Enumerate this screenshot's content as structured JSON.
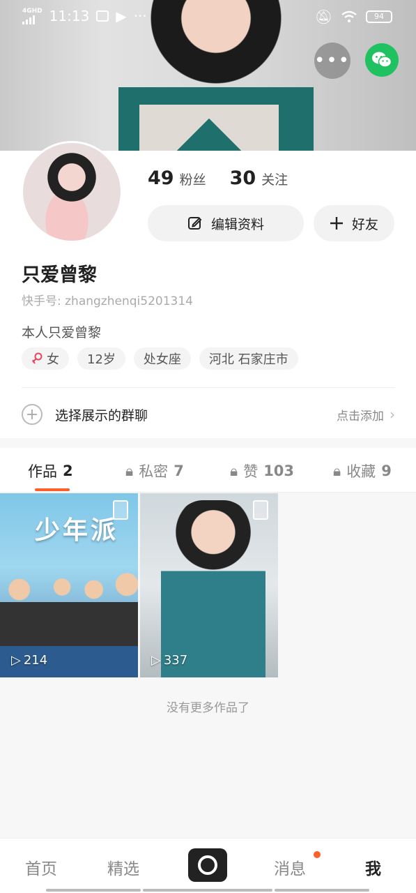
{
  "status_bar": {
    "network": "4GHD",
    "time": "11:13",
    "battery": "94"
  },
  "profile": {
    "followers_count": "49",
    "followers_label": "粉丝",
    "following_count": "30",
    "following_label": "关注",
    "edit_label": "编辑资料",
    "friend_label": "好友",
    "username": "只爱曾黎",
    "kuaishou_id": "快手号: zhangzhenqi5201314",
    "bio": "本人只爱曾黎",
    "tags": [
      "女",
      "12岁",
      "处女座",
      "河北 石家庄市"
    ],
    "group_label": "选择展示的群聊",
    "group_add": "点击添加"
  },
  "tabs": [
    {
      "label": "作品",
      "count": "2"
    },
    {
      "label": "私密",
      "count": "7"
    },
    {
      "label": "赞",
      "count": "103"
    },
    {
      "label": "收藏",
      "count": "9"
    }
  ],
  "videos": [
    {
      "title": "少年派",
      "plays": "214"
    },
    {
      "title": "",
      "plays": "337"
    }
  ],
  "no_more": "没有更多作品了",
  "nav": {
    "home": "首页",
    "featured": "精选",
    "messages": "消息",
    "me": "我"
  },
  "colors": {
    "accent": "#fe5f2a",
    "wechat": "#1fc160"
  }
}
